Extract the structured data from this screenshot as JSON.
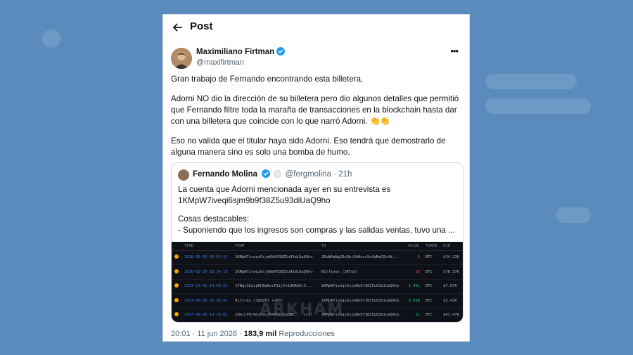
{
  "header": {
    "title": "Post"
  },
  "author": {
    "name": "Maximiliano Firtman",
    "handle": "@maxifirtman"
  },
  "tweet": {
    "paragraphs": [
      "Gran trabajo de Fernando encontrando esta billetera.",
      "Adorni NO dio la dirección de su billetera pero dio algunos detalles que permitió que Fernando filtre toda la maraña de transacciones en la blockchain hasta dar con una billetera que coincide con lo que narró Adorni. 👏👏",
      "Eso no valida que el titular haya sido Adorni. Eso tendrá que demostrarlo de alguna manera sino es solo una bomba de humo."
    ]
  },
  "quote": {
    "name": "Fernando Molina",
    "handle": "@fergmolina",
    "time": "21h",
    "line1": "La cuenta que Adorni mencionada ayer en su entrevista es",
    "line2": "1KMpW7iveqi6sjm9b9f38Z5u93diUaQ9ho",
    "line3": "Cosas destacables:",
    "line4": "- Suponiendo que los ingresos son compras y las salidas ventas, tuvo una ..."
  },
  "media": {
    "watermark": "ARKHAM",
    "columns": [
      "TIME",
      "FROM",
      "TO",
      "VALUE",
      "TOKEN",
      "USD"
    ],
    "rows": [
      {
        "time": "2018-05-05 09:54:31",
        "from": "1KMpW7iveqi6sjm9b9f38Z5u93diUaQ9ho",
        "to": "3DwNKaNg2DxRbjUkHnxx5e3qMeCQk4d...",
        "value": "5",
        "token": "BTC",
        "usd": "$34.23K"
      },
      {
        "time": "2018-02-29 18:14:18",
        "from": "1KMpW7iveqi6sjm9b9f38Z5u93diUaQ9ho",
        "to": "Bitfinex (3KTa3)",
        "value": "10",
        "token": "BTC",
        "usd": "$78.37K"
      },
      {
        "time": "2017-11-02 14:08:51",
        "from": "17Ngx1b2cpRhBw8vcP1ijYx1UWKbKr3...",
        "to": "1KMpW7iveqi6sjm9b9f38Z5u93diUaQ9ho",
        "value": "1.001",
        "token": "BTC",
        "usd": "$7.07K"
      },
      {
        "time": "2017-08-06 20:36:41",
        "from": "Bittrex (3m9ZH) (+95)",
        "to": "1KMpW7iveqi6sjm9b9f38Z5u93diUaQ9ho",
        "value": "0.999",
        "token": "BTC",
        "usd": "$3.41K"
      },
      {
        "time": "2017-08-06 14:18:01",
        "from": "1HeiCP674mio9ij643mZyopnBE... (+1)",
        "to": "1KMpW7iveqi6sjm9b9f38Z5u93diUaQ9ho",
        "value": "11",
        "token": "BTC",
        "usd": "$41.47K"
      }
    ]
  },
  "footer": {
    "datetime": "20:01 · 11 jun 2026",
    "views_count": "183,9 mil",
    "views_label": "Reproducciones"
  },
  "colors": {
    "background": "#5b8bbd",
    "verified": "#1d9bf0",
    "btc": "#f2a900"
  }
}
